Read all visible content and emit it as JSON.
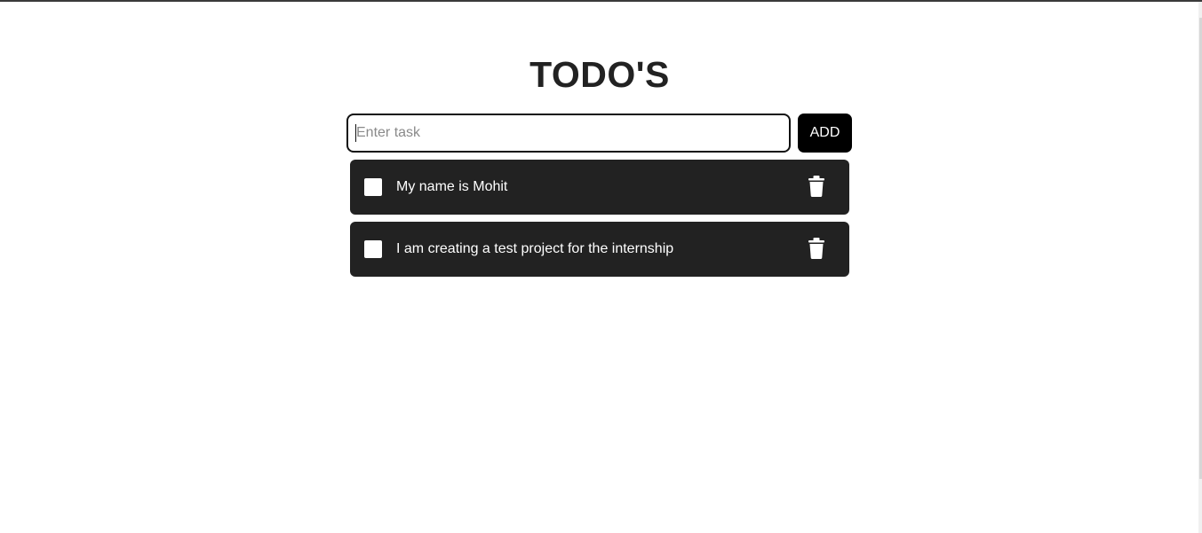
{
  "header": {
    "title": "TODO'S"
  },
  "add_form": {
    "input_value": "",
    "input_placeholder": "Enter task",
    "add_label": "ADD"
  },
  "todos": [
    {
      "text": "My name is Mohit",
      "checked": false
    },
    {
      "text": "I am creating a test project for the internship",
      "checked": false
    }
  ],
  "icons": {
    "delete": "trash-icon"
  },
  "colors": {
    "item_background": "#222222",
    "button_background": "#000000",
    "title_color": "#222222"
  }
}
